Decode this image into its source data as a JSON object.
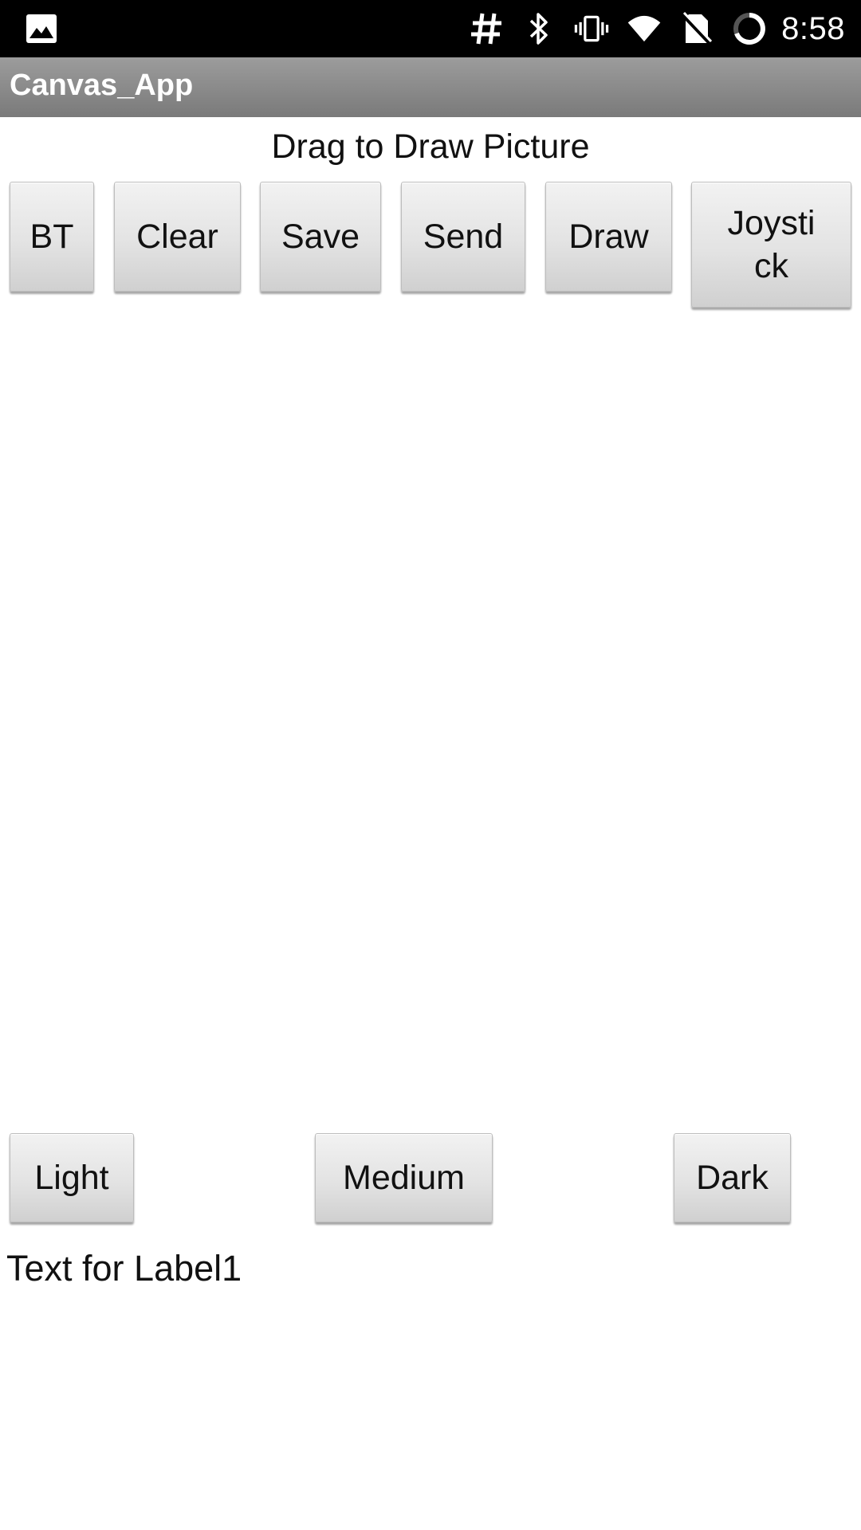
{
  "status_bar": {
    "time": "8:58",
    "icons": [
      "gallery-icon",
      "hash-icon",
      "bluetooth-icon",
      "vibrate-icon",
      "wifi-icon",
      "no-sim-icon",
      "battery-loading-icon"
    ]
  },
  "app": {
    "title": "Canvas_App"
  },
  "main": {
    "heading": "Drag to Draw Picture",
    "top_buttons": {
      "bt": "BT",
      "clear": "Clear",
      "save": "Save",
      "send": "Send",
      "draw": "Draw",
      "joystick_line1": "Joysti",
      "joystick_line2": "ck"
    },
    "shade_buttons": {
      "light": "Light",
      "medium": "Medium",
      "dark": "Dark"
    },
    "label1": "Text for Label1"
  }
}
